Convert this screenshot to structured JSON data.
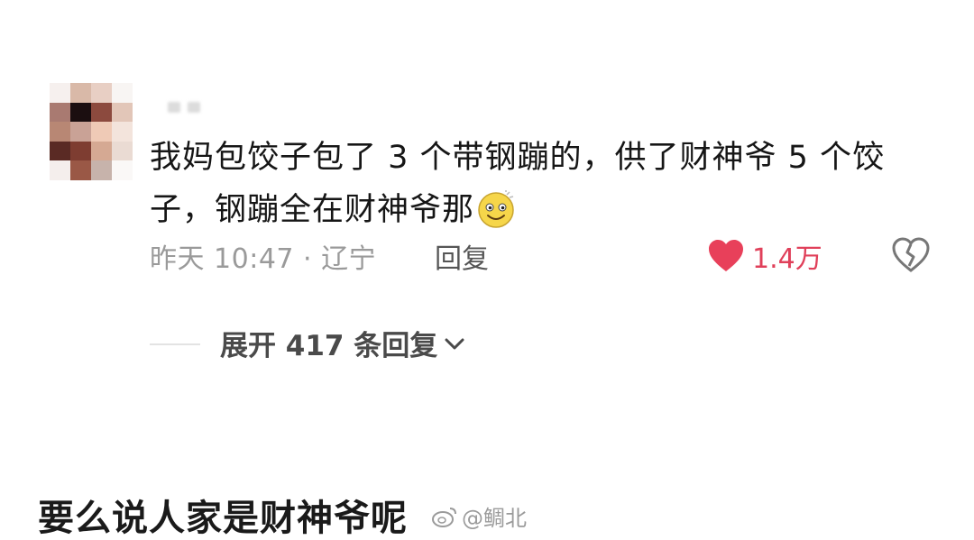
{
  "comment": {
    "text": "我妈包饺子包了 3 个带钢蹦的，供了财神爷 5 个饺子，钢蹦全在财神爷那",
    "emoji": "smiley-emoji",
    "time_location": "昨天 10:47 · 辽宁",
    "reply_label": "回复",
    "like_count": "1.4万"
  },
  "expand": {
    "label": "展开 417 条回复"
  },
  "caption": "要么说人家是财神爷呢",
  "watermark": "@鲷北",
  "colors": {
    "like": "#e0405a",
    "meta": "#9a9a9a",
    "text": "#161616"
  }
}
